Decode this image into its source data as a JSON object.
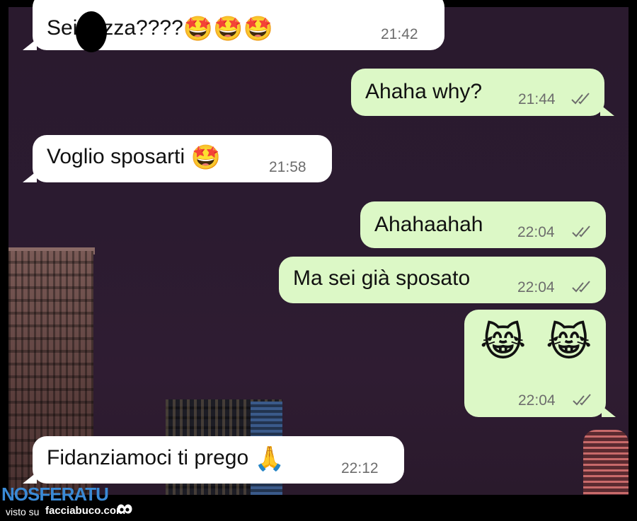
{
  "messages": [
    {
      "direction": "in",
      "text_before": "Sei",
      "text_after": "zza????",
      "emoji": "🤩🤩🤩",
      "time": "21:42"
    },
    {
      "direction": "out",
      "text": "Ahaha why?",
      "time": "21:44",
      "status": "read"
    },
    {
      "direction": "in",
      "text": "Voglio sposarti",
      "emoji": "🤩",
      "time": "21:58"
    },
    {
      "direction": "out",
      "text": "Ahahaahah",
      "time": "22:04",
      "status": "read"
    },
    {
      "direction": "out",
      "text": "Ma sei già sposato",
      "time": "22:04",
      "status": "read"
    },
    {
      "direction": "out",
      "emoji": "😹 😹",
      "time": "22:04",
      "status": "read"
    },
    {
      "direction": "in",
      "text": "Fidanziamoci ti prego",
      "emoji": "🙏",
      "time": "22:12"
    }
  ],
  "footer": {
    "brand": "NOSFERATU",
    "visto_su": "visto su",
    "site": "facciabuco.com"
  },
  "colors": {
    "incoming_bubble": "#ffffff",
    "outgoing_bubble": "#dcf8c6",
    "brand_blue": "#3a8ad6"
  },
  "icons": [
    "double-check-icon",
    "eyes-icon"
  ]
}
